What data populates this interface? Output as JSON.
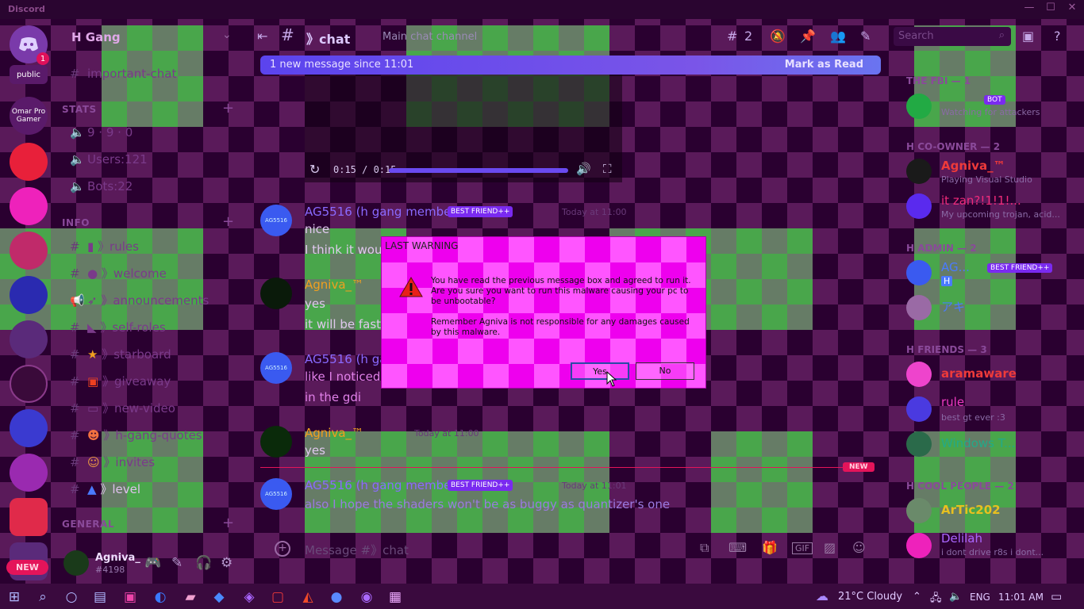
{
  "window": {
    "app_name": "Discord",
    "controls": [
      "—",
      "☐",
      "✕"
    ]
  },
  "servers": [
    {
      "label": "",
      "badge": "1",
      "color": "#7a3aaa",
      "icon": "discord-icon"
    },
    {
      "label": "public",
      "color": "#5a1a6a"
    },
    {
      "label": "Omar Pro Gamer",
      "color": "#5a1a6a"
    },
    {
      "label": "",
      "color": "#e8203a"
    },
    {
      "label": "",
      "color": "#ee22bb"
    },
    {
      "label": "",
      "color": "#c02a6a"
    },
    {
      "label": "",
      "color": "#2a2ab0"
    },
    {
      "label": "",
      "color": "#5a2a7a"
    },
    {
      "label": "",
      "color": "#3a0a3a"
    },
    {
      "label": "",
      "color": "#3a3ad0"
    },
    {
      "label": "",
      "color": "#9a2ab0"
    },
    {
      "label": "",
      "color": "#e02a4a"
    }
  ],
  "guild": {
    "name": "H Gang"
  },
  "channels": {
    "top": {
      "name": "important-chat"
    },
    "stats_cat": "STATS",
    "stats": [
      {
        "text": "9 · 9 · 0"
      },
      {
        "text": "Users:121"
      },
      {
        "text": "Bots:22"
      }
    ],
    "info_cat": "INFO",
    "info": [
      {
        "emoji": "▮",
        "name": "》rules"
      },
      {
        "emoji": "●",
        "name": "》welcome"
      },
      {
        "emoji": "➶",
        "name": "》announcements"
      },
      {
        "emoji": "◣",
        "name": "》self-roles"
      },
      {
        "emoji": "★",
        "name": "》starboard"
      },
      {
        "emoji": "▣",
        "name": "》giveaway"
      },
      {
        "emoji": "▭",
        "name": "》new-video"
      },
      {
        "emoji": "☻",
        "name": "》h-gang-quotes"
      },
      {
        "emoji": "☺",
        "name": "》invites"
      },
      {
        "emoji": "▲",
        "name": "》level"
      }
    ],
    "general_cat": "GENERAL"
  },
  "header": {
    "channel": "》chat",
    "topic": "Main chat channel",
    "threads_count": "2",
    "search_placeholder": "Search"
  },
  "new_message_bar": {
    "text": "1 new message since 11:01",
    "action": "Mark as Read"
  },
  "media": {
    "time": "0:15 / 0:15"
  },
  "messages": [
    {
      "author": "AG5516 (h gang member)",
      "tag": "BEST FRIEND++",
      "time": "Today at 11:00",
      "avatar": "AG5516",
      "lines": [
        "nice",
        "I think it would"
      ]
    },
    {
      "author": "Agniva_™",
      "tag": "",
      "time": "",
      "avatar": "",
      "lines": [
        "yes",
        "it will be fast"
      ]
    },
    {
      "author": "AG5516 (h gang",
      "tag": "",
      "time": "",
      "avatar": "AG5516",
      "lines": [
        "like I noticed s",
        "in the gdi"
      ]
    },
    {
      "author": "Agniva_™",
      "tag": "",
      "time": "Today at 11:00",
      "avatar": "",
      "lines": [
        "yes"
      ]
    },
    {
      "author": "AG5516 (h gang member)",
      "tag": "BEST FRIEND++",
      "time": "Today at 11:01",
      "avatar": "AG5516",
      "lines": [
        "also I hope the shaders won't be as buggy as quantizer's one"
      ]
    }
  ],
  "new_label": "NEW",
  "composer": {
    "placeholder": "Message #》chat"
  },
  "user": {
    "name": "Agniva_",
    "discriminator": "#4198",
    "new_badge": "NEW"
  },
  "members": {
    "groups": [
      {
        "title": "THE FBI — 1"
      },
      {
        "title": "H CO-OWNER — 2"
      },
      {
        "title": "H ADMIN — 2"
      },
      {
        "title": "H FRIENDS — 3"
      },
      {
        "title": "H COOL PEOPLE — 2"
      }
    ],
    "list": [
      {
        "name": "",
        "tag": "BOT",
        "status": "Watching for attackers",
        "color": "#22aa44"
      },
      {
        "name": "Agniva_™",
        "tag": "",
        "status": "Playing Visual Studio",
        "color": "#ee3a3a"
      },
      {
        "name": "it zan?!1!1!...",
        "tag": "",
        "status": "My upcoming trojan, acid...",
        "color": "#ee2a7a"
      },
      {
        "name": "AG...",
        "tag": "BEST FRIEND++",
        "status": "H",
        "color": "#4a7aff"
      },
      {
        "name": "アキ",
        "tag": "",
        "status": "",
        "color": "#4a7aff"
      },
      {
        "name": "aramaware",
        "tag": "",
        "status": "",
        "color": "#ee3a3a"
      },
      {
        "name": "rule",
        "tag": "",
        "status": "best gt ever :3",
        "color": "#ee3ac0"
      },
      {
        "name": "Windows T...",
        "tag": "",
        "status": "",
        "color": "#22aa88"
      },
      {
        "name": "ArTic202",
        "tag": "",
        "status": "",
        "color": "#e8c020"
      },
      {
        "name": "Delilah",
        "tag": "",
        "status": "i dont drive r8s i dont...",
        "color": "#aa66ff"
      }
    ]
  },
  "dialog": {
    "title": "LAST WARNING",
    "line1": "You have read the previous message box and agreed to run it.",
    "line2": "Are you sure you want to run this malware causing your pc to",
    "line3": "be unbootable?",
    "line4": "Remember Agniva is not responsible for any damages caused",
    "line5": "by this malware.",
    "yes": "Yes",
    "no": "No"
  },
  "taskbar": {
    "weather": "21°C  Cloudy",
    "lang": "ENG",
    "time": "11:01 AM"
  }
}
